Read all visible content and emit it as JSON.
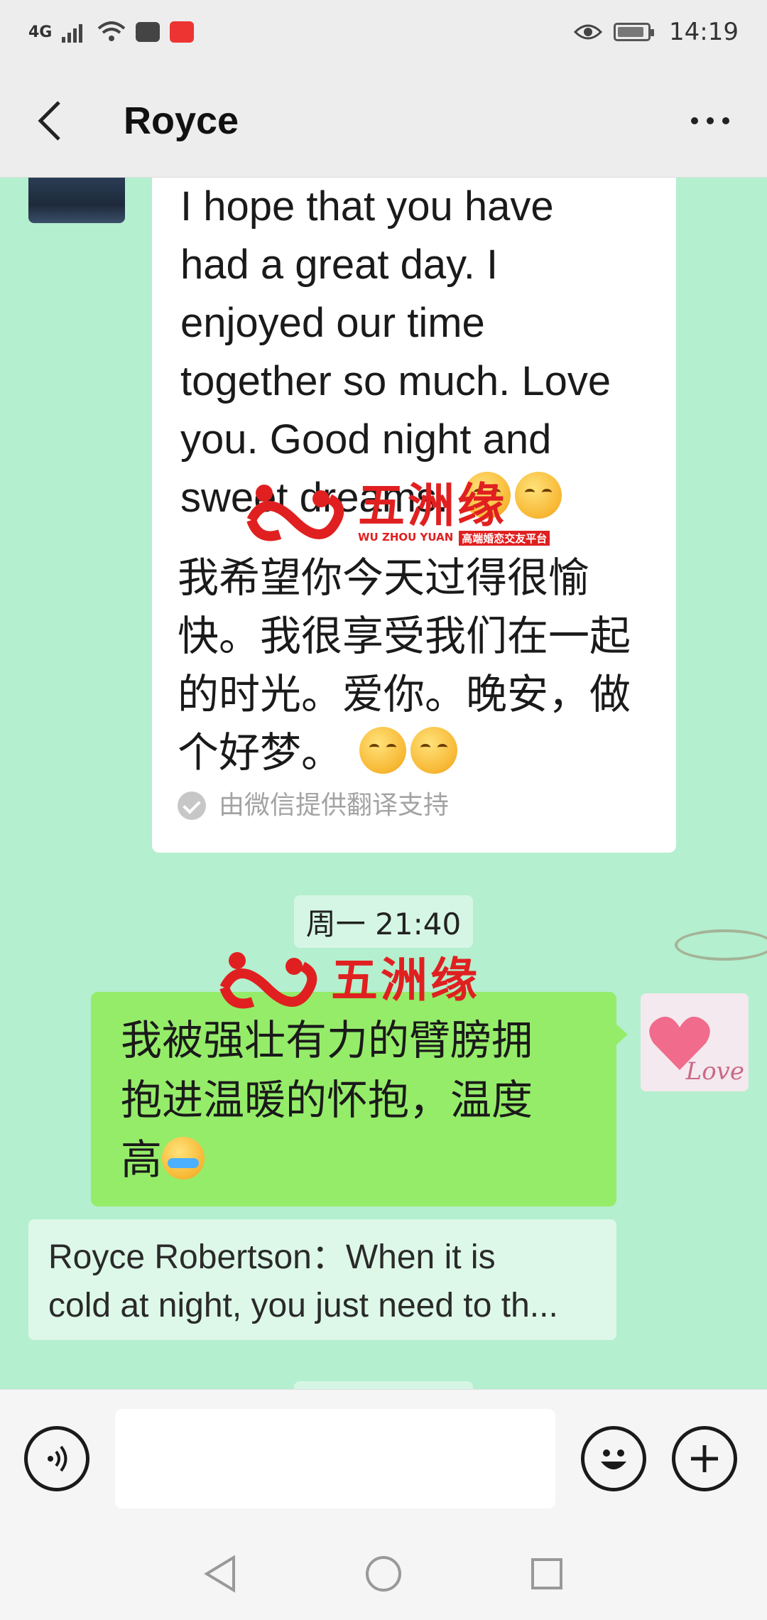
{
  "status_bar": {
    "network": "4G",
    "time": "14:19"
  },
  "header": {
    "title": "Royce"
  },
  "messages": {
    "english": "I hope that you have had a great day. I enjoyed our time together so much. Love you. Good night and sweet dreams.",
    "english_lines": [
      "I hope that you have",
      "had a great day. I",
      "enjoyed our time",
      "together so much. Love",
      "you. Good night and",
      "sweet dreams."
    ],
    "translation_lines": [
      "我希望你今天过得很愉",
      "快。我很享受我们在一起",
      "的时光。爱你。晚安，做",
      "个好梦。"
    ],
    "translation_note": "由微信提供翻译支持",
    "time_label": "周一 21:40",
    "my_message_lines": [
      "我被强壮有力的臂膀拥",
      "抱进温暖的怀抱，温度",
      "高"
    ],
    "quote_lines": [
      "Royce Robertson：When it is",
      "cold at night, you just need to th..."
    ]
  },
  "watermark": {
    "cn": "五洲缘",
    "en": "WU ZHOU YUAN",
    "tag": "高端婚恋交友平台"
  },
  "avatar_me": {
    "text": "Love"
  },
  "icons": {
    "voice": "voice-icon",
    "emoji": "emoji-icon",
    "plus": "plus-icon",
    "back": "back-icon",
    "more": "more-icon"
  },
  "colors": {
    "chat_background": "#b4efcf",
    "my_bubble": "#95ec69",
    "watermark_red": "#e02020"
  }
}
